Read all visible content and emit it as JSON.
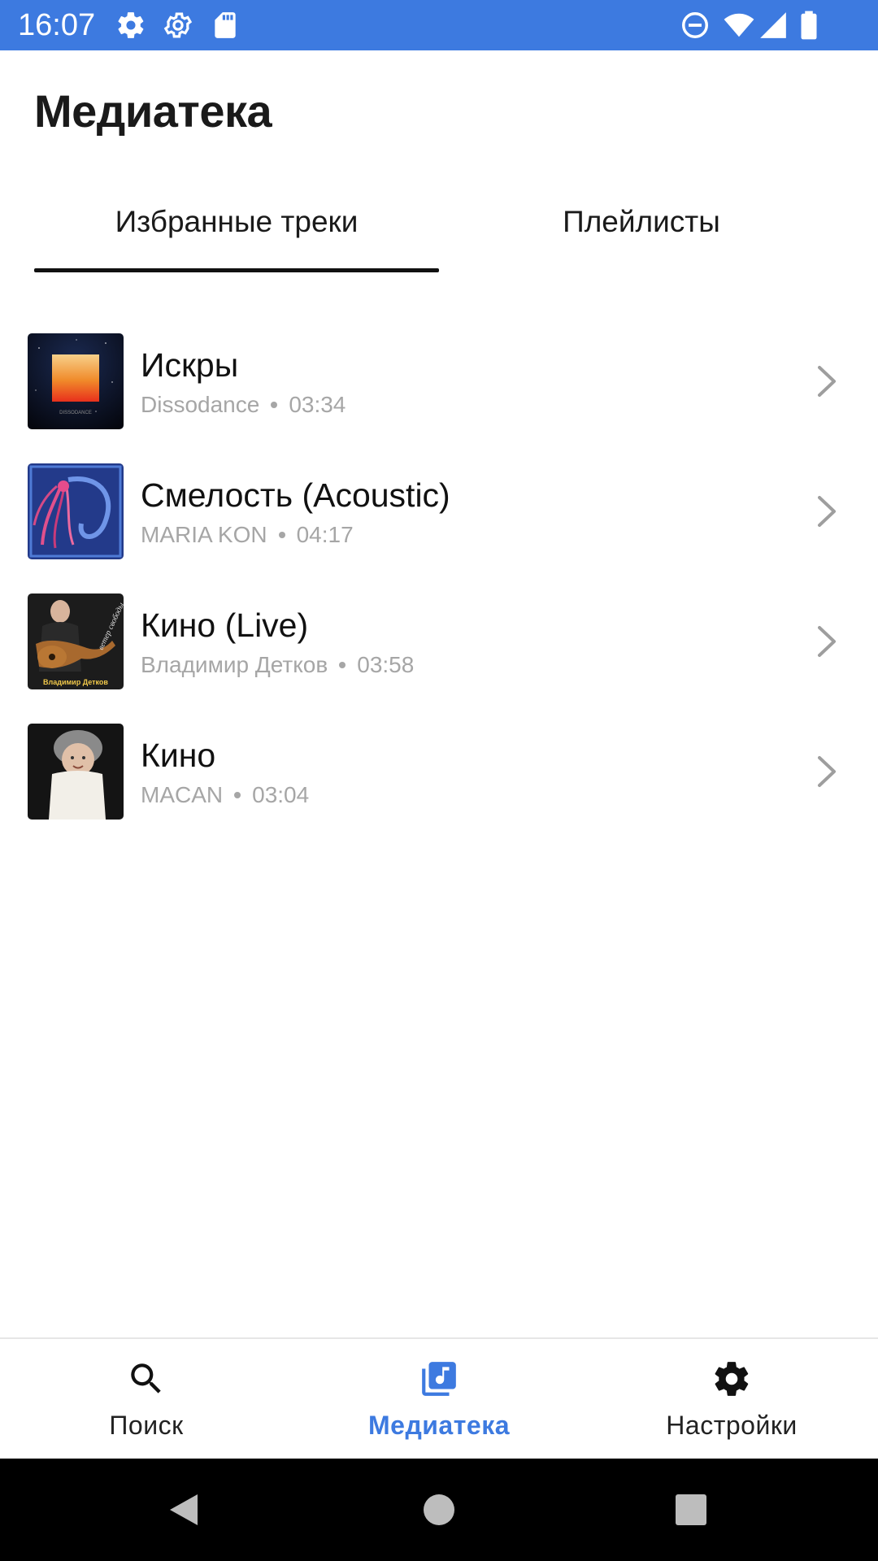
{
  "status_bar": {
    "time": "16:07",
    "left_icons": [
      "gear-icon",
      "gear-outline-icon",
      "sd-card-icon"
    ],
    "right_icons": [
      "do-not-disturb-icon",
      "wifi-icon",
      "signal-icon",
      "battery-icon"
    ],
    "background": "#3d7ae0"
  },
  "header": {
    "title": "Медиатека"
  },
  "tabs": [
    {
      "label": "Избранные треки",
      "active": true
    },
    {
      "label": "Плейлисты",
      "active": false
    }
  ],
  "tracks": [
    {
      "title": "Искры",
      "artist": "Dissodance",
      "duration": "03:34",
      "cover_text": "DISSODANCE"
    },
    {
      "title": "Смелость (Acoustic)",
      "artist": "MARIA KON",
      "duration": "04:17"
    },
    {
      "title": "Кино (Live)",
      "artist": "Владимир Детков",
      "duration": "03:58",
      "cover_text": "Владимир Детков",
      "cover_script": "ветер свободы"
    },
    {
      "title": "Кино",
      "artist": "MACAN",
      "duration": "03:04"
    }
  ],
  "bottom_nav": {
    "items": [
      {
        "label": "Поиск",
        "icon": "search-icon",
        "active": false
      },
      {
        "label": "Медиатека",
        "icon": "music-library-icon",
        "active": true
      },
      {
        "label": "Настройки",
        "icon": "settings-icon",
        "active": false
      }
    ],
    "active_color": "#3d7ae0"
  },
  "system_nav": {
    "buttons": [
      "back-icon",
      "home-icon",
      "recents-icon"
    ]
  }
}
